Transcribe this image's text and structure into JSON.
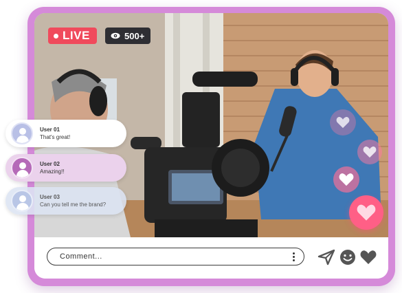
{
  "stream": {
    "live_label": "LIVE",
    "viewer_count": "500+"
  },
  "comments": [
    {
      "user": "User 01",
      "message": "That's great!"
    },
    {
      "user": "User 02",
      "message": "Amazing!!"
    },
    {
      "user": "User 03",
      "message": "Can you tell me the brand?"
    }
  ],
  "composer": {
    "placeholder": "Comment..."
  },
  "icons": {
    "send": "send-icon",
    "emoji": "smiley-icon",
    "like": "heart-icon",
    "viewers": "eye-icon",
    "more": "kebab-menu-icon"
  },
  "colors": {
    "frame": "#d58ad9",
    "live": "#f04a5c",
    "viewers_badge": "#2e2e33",
    "reaction_heart": "#ff5f86"
  }
}
